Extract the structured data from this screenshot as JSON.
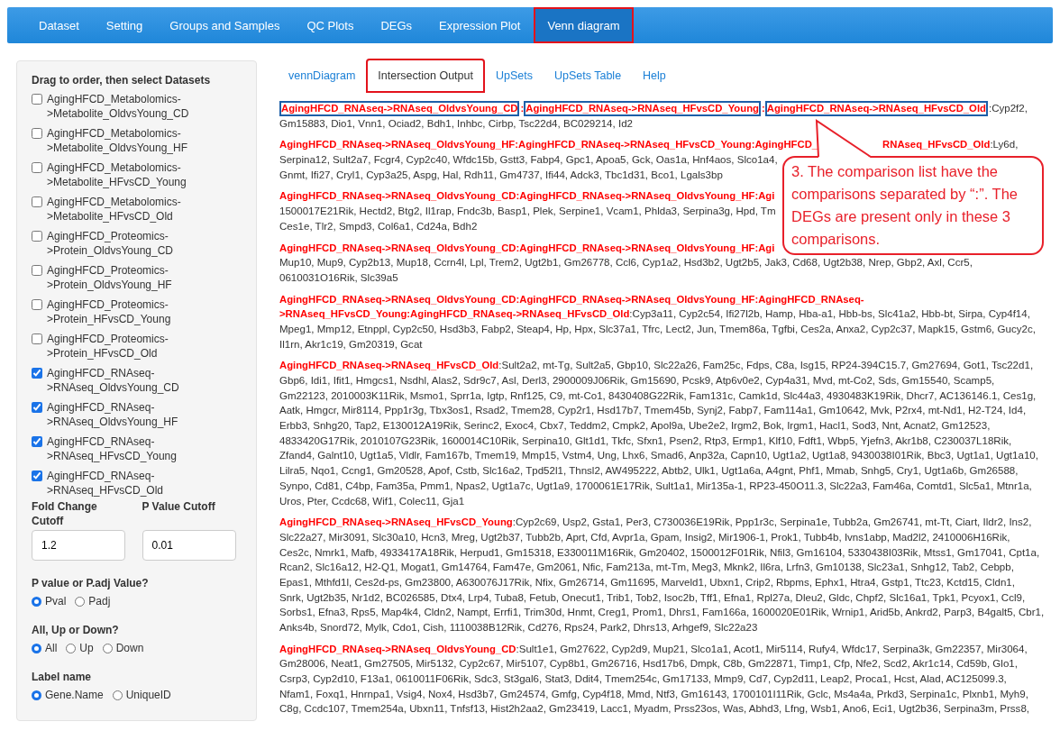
{
  "navbar": {
    "tabs": [
      {
        "label": "Dataset",
        "selected": false,
        "highlighted": false
      },
      {
        "label": "Setting",
        "selected": false,
        "highlighted": false
      },
      {
        "label": "Groups and Samples",
        "selected": false,
        "highlighted": false
      },
      {
        "label": "QC Plots",
        "selected": false,
        "highlighted": false
      },
      {
        "label": "DEGs",
        "selected": false,
        "highlighted": false
      },
      {
        "label": "Expression Plot",
        "selected": false,
        "highlighted": false
      },
      {
        "label": "Venn diagram",
        "selected": true,
        "highlighted": true
      }
    ]
  },
  "sidebar": {
    "datasets_title": "Drag to order, then select Datasets",
    "datasets": [
      {
        "label": "AgingHFCD_Metabolomics->Metabolite_OldvsYoung_CD",
        "checked": false
      },
      {
        "label": "AgingHFCD_Metabolomics->Metabolite_OldvsYoung_HF",
        "checked": false
      },
      {
        "label": "AgingHFCD_Metabolomics->Metabolite_HFvsCD_Young",
        "checked": false
      },
      {
        "label": "AgingHFCD_Metabolomics->Metabolite_HFvsCD_Old",
        "checked": false
      },
      {
        "label": "AgingHFCD_Proteomics->Protein_OldvsYoung_CD",
        "checked": false
      },
      {
        "label": "AgingHFCD_Proteomics->Protein_OldvsYoung_HF",
        "checked": false
      },
      {
        "label": "AgingHFCD_Proteomics->Protein_HFvsCD_Young",
        "checked": false
      },
      {
        "label": "AgingHFCD_Proteomics->Protein_HFvsCD_Old",
        "checked": false
      },
      {
        "label": "AgingHFCD_RNAseq->RNAseq_OldvsYoung_CD",
        "checked": true
      },
      {
        "label": "AgingHFCD_RNAseq->RNAseq_OldvsYoung_HF",
        "checked": true
      },
      {
        "label": "AgingHFCD_RNAseq->RNAseq_HFvsCD_Young",
        "checked": true
      },
      {
        "label": "AgingHFCD_RNAseq->RNAseq_HFvsCD_Old",
        "checked": true
      }
    ],
    "fold_change": {
      "label": "Fold Change Cutoff",
      "value": "1.2"
    },
    "p_value": {
      "label": "P Value Cutoff",
      "value": "0.01"
    },
    "radio_groups": [
      {
        "label": "P value or P.adj Value?",
        "options": [
          {
            "label": "Pval",
            "selected": true
          },
          {
            "label": "Padj",
            "selected": false
          }
        ]
      },
      {
        "label": "All, Up or Down?",
        "options": [
          {
            "label": "All",
            "selected": true
          },
          {
            "label": "Up",
            "selected": false
          },
          {
            "label": "Down",
            "selected": false
          }
        ]
      },
      {
        "label": "Label name",
        "options": [
          {
            "label": "Gene.Name",
            "selected": true
          },
          {
            "label": "UniqueID",
            "selected": false
          }
        ]
      }
    ]
  },
  "main": {
    "tabs": [
      {
        "label": "vennDiagram",
        "selected": false,
        "highlighted": false
      },
      {
        "label": "Intersection Output",
        "selected": true,
        "highlighted": true
      },
      {
        "label": "UpSets",
        "selected": false,
        "highlighted": false
      },
      {
        "label": "UpSets Table",
        "selected": false,
        "highlighted": false
      },
      {
        "label": "Help",
        "selected": false,
        "highlighted": false
      }
    ],
    "entries": [
      {
        "lines": [
          [
            {
              "kind": "boxed",
              "text": "AgingHFCD_RNAseq->RNAseq_OldvsYoung_CD"
            },
            {
              "kind": "comparison",
              "text": ":"
            },
            {
              "kind": "boxed",
              "text": "AgingHFCD_RNAseq->RNAseq_HFvsCD_Young"
            },
            {
              "kind": "comparison",
              "text": ":"
            },
            {
              "kind": "boxed",
              "text": "AgingHFCD_RNAseq->RNAseq_HFvsCD_Old"
            },
            {
              "kind": "genes",
              "text": ":Cyp2f2,"
            }
          ],
          [
            {
              "kind": "genes",
              "text": "Gm15883, Dio1, Vnn1, Ociad2, Bdh1, Inhbc, Cirbp, Tsc22d4, BC029214, Id2"
            }
          ]
        ]
      },
      {
        "lines": [
          [
            {
              "kind": "comparison",
              "text": "AgingHFCD_RNAseq->RNAseq_OldvsYoung_HF:AgingHFCD_RNAseq->RNAseq_HFvsCD_Young:AgingHFCD_"
            },
            {
              "kind": "covered"
            },
            {
              "kind": "comparison",
              "text": "RNAseq_HFvsCD_Old"
            },
            {
              "kind": "genes",
              "text": ":Ly6d,"
            }
          ],
          [
            {
              "kind": "genes",
              "text": "Serpina12, Sult2a7, Fcgr4, Cyp2c40, Wfdc15b, Gstt3, Fabp4, Gpc1, Apoa5, Gck, Oas1a, Hnf4aos, Slco1a4,"
            }
          ],
          [
            {
              "kind": "genes",
              "text": "Gnmt, Ifi27, Cryl1, Cyp3a25, Aspg, Hal, Rdh11, Gm4737, Ifi44, Adck3, Tbc1d31, Bco1, Lgals3bp"
            }
          ]
        ]
      },
      {
        "lines": [
          [
            {
              "kind": "comparison",
              "text": "AgingHFCD_RNAseq->RNAseq_OldvsYoung_CD:AgingHFCD_RNAseq->RNAseq_OldvsYoung_HF:Agi"
            }
          ],
          [
            {
              "kind": "genes",
              "text": "1500017E21Rik, Hectd2, Btg2, Il1rap, Fndc3b, Basp1, Plek, Serpine1, Vcam1, Phlda3, Serpina3g, Hpd, Tm"
            }
          ],
          [
            {
              "kind": "genes",
              "text": "Ces1e, Tlr2, Smpd3, Col6a1, Cd24a, Bdh2"
            }
          ]
        ]
      },
      {
        "lines": [
          [
            {
              "kind": "comparison",
              "text": "AgingHFCD_RNAseq->RNAseq_OldvsYoung_CD:AgingHFCD_RNAseq->RNAseq_OldvsYoung_HF:Agi"
            }
          ],
          [
            {
              "kind": "genes",
              "text": "Mup10, Mup9, Cyp2b13, Mup18, Ccrn4l, Lpl, Trem2, Ugt2b1, Gm26778, Ccl6, Cyp1a2, Hsd3b2, Ugt2b5, Jak3, Cd68, Ugt2b38, Nrep, Gbp2, Axl, Ccr5,"
            }
          ],
          [
            {
              "kind": "genes",
              "text": "0610031O16Rik, Slc39a5"
            }
          ]
        ]
      },
      {
        "lines": [
          [
            {
              "kind": "comparison",
              "text": "AgingHFCD_RNAseq->RNAseq_OldvsYoung_CD:AgingHFCD_RNAseq->RNAseq_OldvsYoung_HF:AgingHFCD_RNAseq-"
            }
          ],
          [
            {
              "kind": "comparison",
              "text": ">RNAseq_HFvsCD_Young:AgingHFCD_RNAseq->RNAseq_HFvsCD_Old"
            },
            {
              "kind": "genes",
              "text": ":Cyp3a11, Cyp2c54, Ifi27l2b, Hamp, Hba-a1, Hbb-bs, Slc41a2, Hbb-bt, Sirpa, Cyp4f14,"
            }
          ],
          [
            {
              "kind": "genes",
              "text": "Mpeg1, Mmp12, Etnppl, Cyp2c50, Hsd3b3, Fabp2, Steap4, Hp, Hpx, Slc37a1, Tfrc, Lect2, Jun, Tmem86a, Tgfbi, Ces2a, Anxa2, Cyp2c37, Mapk15, Gstm6, Gucy2c,"
            }
          ],
          [
            {
              "kind": "genes",
              "text": "Il1rn, Akr1c19, Gm20319, Gcat"
            }
          ]
        ]
      },
      {
        "lines": [
          [
            {
              "kind": "comparison",
              "text": "AgingHFCD_RNAseq->RNAseq_HFvsCD_Old"
            },
            {
              "kind": "genes",
              "text": ":Sult2a2, mt-Tg, Sult2a5, Gbp10, Slc22a26, Fam25c, Fdps, C8a, Isg15, RP24-394C15.7, Gm27694, Got1, Tsc22d1,"
            }
          ],
          [
            {
              "kind": "genes",
              "text": "Gbp6, Idi1, Ifit1, Hmgcs1, Nsdhl, Alas2, Sdr9c7, Asl, Derl3, 2900009J06Rik, Gm15690, Pcsk9, Atp6v0e2, Cyp4a31, Mvd, mt-Co2, Sds, Gm15540, Scamp5,"
            }
          ],
          [
            {
              "kind": "genes",
              "text": "Gm22123, 2010003K11Rik, Msmo1, Sprr1a, Igtp, Rnf125, C9, mt-Co1, 8430408G22Rik, Fam131c, Camk1d, Slc44a3, 4930483K19Rik, Dhcr7, AC136146.1, Ces1g,"
            }
          ],
          [
            {
              "kind": "genes",
              "text": "Aatk, Hmgcr, Mir8114, Ppp1r3g, Tbx3os1, Rsad2, Tmem28, Cyp2r1, Hsd17b7, Tmem45b, Synj2, Fabp7, Fam114a1, Gm10642, Mvk, P2rx4, mt-Nd1, H2-T24, Id4,"
            }
          ],
          [
            {
              "kind": "genes",
              "text": "Erbb3, Snhg20, Tap2, E130012A19Rik, Serinc2, Exoc4, Cbx7, Teddm2, Cmpk2, Apol9a, Ube2e2, Irgm2, Bok, Irgm1, Hacl1, Sod3, Nnt, Acnat2, Gm12523,"
            }
          ],
          [
            {
              "kind": "genes",
              "text": "4833420G17Rik, 2010107G23Rik, 1600014C10Rik, Serpina10, Glt1d1, Tkfc, Sfxn1, Psen2, Rtp3, Ermp1, Klf10, Fdft1, Wbp5, Yjefn3, Akr1b8, C230037L18Rik,"
            }
          ],
          [
            {
              "kind": "genes",
              "text": "Zfand4, Galnt10, Ugt1a5, Vldlr, Fam167b, Tmem19, Mmp15, Vstm4, Ung, Lhx6, Smad6, Anp32a, Capn10, Ugt1a2, Ugt1a8, 9430038I01Rik, Bbc3, Ugt1a1, Ugt1a10,"
            }
          ],
          [
            {
              "kind": "genes",
              "text": "Lilra5, Nqo1, Ccng1, Gm20528, Apof, Cstb, Slc16a2, Tpd52l1, Thnsl2, AW495222, Abtb2, Ulk1, Ugt1a6a, A4gnt, Phf1, Mmab, Snhg5, Cry1, Ugt1a6b, Gm26588,"
            }
          ],
          [
            {
              "kind": "genes",
              "text": "Synpo, Cd81, C4bp, Fam35a, Pmm1, Npas2, Ugt1a7c, Ugt1a9, 1700061E17Rik, Sult1a1, Mir135a-1, RP23-450O11.3, Slc22a3, Fam46a, Comtd1, Slc5a1, Mtnr1a,"
            }
          ],
          [
            {
              "kind": "genes",
              "text": "Uros, Pter, Ccdc68, Wif1, Colec11, Gja1"
            }
          ]
        ]
      },
      {
        "lines": [
          [
            {
              "kind": "comparison",
              "text": "AgingHFCD_RNAseq->RNAseq_HFvsCD_Young"
            },
            {
              "kind": "genes",
              "text": ":Cyp2c69, Usp2, Gsta1, Per3, C730036E19Rik, Ppp1r3c, Serpina1e, Tubb2a, Gm26741, mt-Tt, Ciart, Ildr2, Ins2,"
            }
          ],
          [
            {
              "kind": "genes",
              "text": "Slc22a27, Mir3091, Slc30a10, Hcn3, Mreg, Ugt2b37, Tubb2b, Aprt, Cfd, Avpr1a, Gpam, Insig2, Mir1906-1, Prok1, Tubb4b, Ivns1abp, Mad2l2, 2410006H16Rik,"
            }
          ],
          [
            {
              "kind": "genes",
              "text": "Ces2c, Nmrk1, Mafb, 4933417A18Rik, Herpud1, Gm15318, E330011M16Rik, Gm20402, 1500012F01Rik, Nfil3, Gm16104, 5330438I03Rik, Mtss1, Gm17041, Cpt1a,"
            }
          ],
          [
            {
              "kind": "genes",
              "text": "Rcan2, Slc16a12, H2-Q1, Mogat1, Gm14764, Fam47e, Gm2061, Nfic, Fam213a, mt-Tm, Meg3, Mknk2, Il6ra, Lrfn3, Gm10138, Slc23a1, Snhg12, Tab2, Cebpb,"
            }
          ],
          [
            {
              "kind": "genes",
              "text": "Epas1, Mthfd1l, Ces2d-ps, Gm23800, A630076J17Rik, Nfix, Gm26714, Gm11695, Marveld1, Ubxn1, Crip2, Rbpms, Ephx1, Htra4, Gstp1, Ttc23, Kctd15, Cldn1,"
            }
          ],
          [
            {
              "kind": "genes",
              "text": "Snrk, Ugt2b35, Nr1d2, BC026585, Dtx4, Lrp4, Tuba8, Fetub, Onecut1, Trib1, Tob2, Isoc2b, Tff1, Efna1, Rpl27a, Dleu2, Gldc, Chpf2, Slc16a1, Tpk1, Pcyox1, Ccl9,"
            }
          ],
          [
            {
              "kind": "genes",
              "text": "Sorbs1, Efna3, Rps5, Map4k4, Cldn2, Nampt, Errfi1, Trim30d, Hnmt, Creg1, Prom1, Dhrs1, Fam166a, 1600020E01Rik, Wrnip1, Arid5b, Ankrd2, Parp3, B4galt5, Cbr1,"
            }
          ],
          [
            {
              "kind": "genes",
              "text": "Anks4b, Snord72, Mylk, Cdo1, Cish, 1110038B12Rik, Cd276, Rps24, Park2, Dhrs13, Arhgef9, Slc22a23"
            }
          ]
        ]
      },
      {
        "lines": [
          [
            {
              "kind": "comparison",
              "text": "AgingHFCD_RNAseq->RNAseq_OldvsYoung_CD"
            },
            {
              "kind": "genes",
              "text": ":Sult1e1, Gm27622, Cyp2d9, Mup21, Slco1a1, Acot1, Mir5114, Rufy4, Wfdc17, Serpina3k, Gm22357, Mir3064,"
            }
          ],
          [
            {
              "kind": "genes",
              "text": "Gm28006, Neat1, Gm27505, Mir5132, Cyp2c67, Mir5107, Cyp8b1, Gm26716, Hsd17b6, Dmpk, C8b, Gm22871, Timp1, Cfp, Nfe2, Scd2, Akr1c14, Cd59b, Glo1,"
            }
          ],
          [
            {
              "kind": "genes",
              "text": "Csrp3, Cyp2d10, F13a1, 0610011F06Rik, Sdc3, St3gal6, Stat3, Ddit4, Tmem254c, Gm17133, Mmp9, Cd7, Cyp2d11, Leap2, Proca1, Hcst, Alad, AC125099.3,"
            }
          ],
          [
            {
              "kind": "genes",
              "text": "Nfam1, Foxq1, Hnrnpa1, Vsig4, Nox4, Hsd3b7, Gm24574, Gmfg, Cyp4f18, Mmd, Ntf3, Gm16143, 1700101I11Rik, Gclc, Ms4a4a, Prkd3, Serpina1c, Plxnb1, Myh9,"
            }
          ],
          [
            {
              "kind": "genes",
              "text": "C8g, Ccdc107, Tmem254a, Ubxn11, Tnfsf13, Hist2h2aa2, Gm23419, Lacc1, Myadm, Prss23os, Was, Abhd3, Lfng, Wsb1, Ano6, Eci1, Ugt2b36, Serpina3m, Prss8,"
            }
          ]
        ]
      }
    ],
    "callout": {
      "text": "3. The comparison list have the comparisons separated by “:”. The DEGs are present only in these 3 comparisons."
    }
  }
}
